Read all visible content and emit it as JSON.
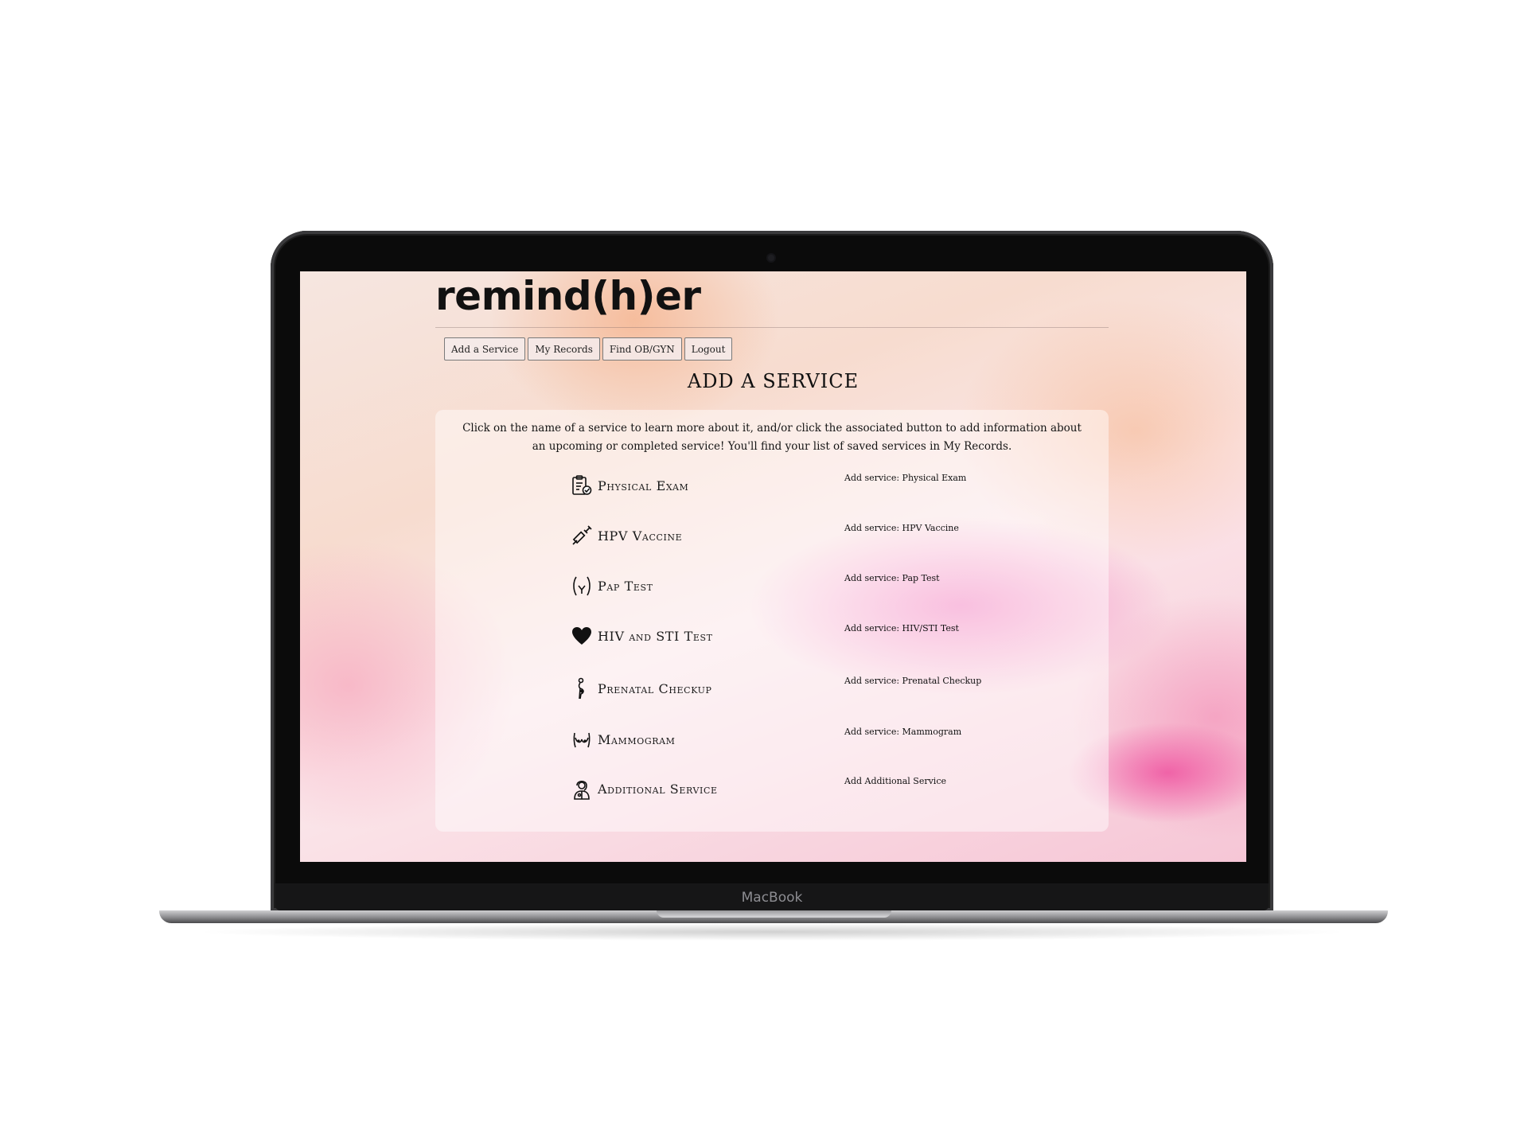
{
  "device": {
    "brand": "MacBook"
  },
  "app": {
    "logo": "remind(h)er"
  },
  "nav": {
    "items": [
      {
        "label": "Add a Service"
      },
      {
        "label": "My Records"
      },
      {
        "label": "Find OB/GYN"
      },
      {
        "label": "Logout"
      }
    ]
  },
  "page": {
    "title": "ADD A SERVICE",
    "intro": "Click on the name of a service to learn more about it, and/or click the associated button to add information about an upcoming or completed service! You'll find your list of saved services in My Records."
  },
  "services": [
    {
      "name": "Physical Exam",
      "icon": "clipboard-check-icon",
      "action": "Add service: Physical Exam"
    },
    {
      "name": "HPV Vaccine",
      "icon": "syringe-icon",
      "action": "Add service: HPV Vaccine"
    },
    {
      "name": "Pap Test",
      "icon": "pelvis-icon",
      "action": "Add service: Pap Test"
    },
    {
      "name": "HIV and STI Test",
      "icon": "heart-icon",
      "action": "Add service: HIV/STI Test"
    },
    {
      "name": "Prenatal Checkup",
      "icon": "pregnant-woman-icon",
      "action": "Add service: Prenatal Checkup"
    },
    {
      "name": "Mammogram",
      "icon": "breast-icon",
      "action": "Add service: Mammogram"
    },
    {
      "name": "Additional Service",
      "icon": "doctor-icon",
      "action": "Add Additional Service"
    }
  ]
}
